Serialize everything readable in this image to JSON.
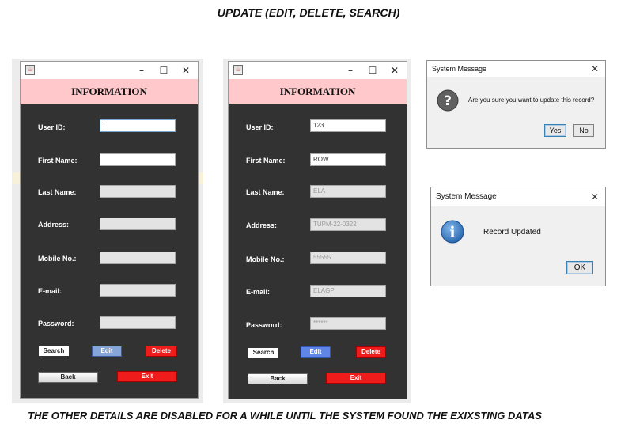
{
  "heading": "UPDATE (EDIT, DELETE, SEARCH)",
  "footer": "THE OTHER DETAILS ARE DISABLED FOR A WHILE UNTIL THE SYSTEM FOUND THE EXIXSTING DATAS",
  "window_controls": {
    "minimize": "–",
    "maximize": "☐",
    "close": "✕"
  },
  "form": {
    "title": "INFORMATION",
    "labels": {
      "user_id": "User ID:",
      "first_name": "First Name:",
      "last_name": "Last Name:",
      "address": "Address:",
      "mobile": "Mobile No.:",
      "email": "E-mail:",
      "password": "Password:"
    },
    "buttons": {
      "search": "Search",
      "edit": "Edit",
      "delete": "Delete",
      "back": "Back",
      "exit": "Exit"
    }
  },
  "form2_values": {
    "user_id": "123",
    "first_name": "ROW",
    "last_name": "ELA",
    "address": "TUPM-22-0322",
    "mobile": "55555",
    "email": "ELAGP",
    "password": "******"
  },
  "dialog_confirm": {
    "title": "System Message",
    "message": "Are you sure you want to update this record?",
    "yes": "Yes",
    "no": "No",
    "close": "✕",
    "icon": "question-icon"
  },
  "dialog_info": {
    "title": "System Message",
    "message": "Record Updated",
    "ok": "OK",
    "close": "✕",
    "icon": "info-icon"
  },
  "colors": {
    "form_bg": "#323232",
    "title_bar": "#ffc9cb",
    "delete_exit": "#ef1c1c",
    "edit_button": "#86a5d8"
  }
}
